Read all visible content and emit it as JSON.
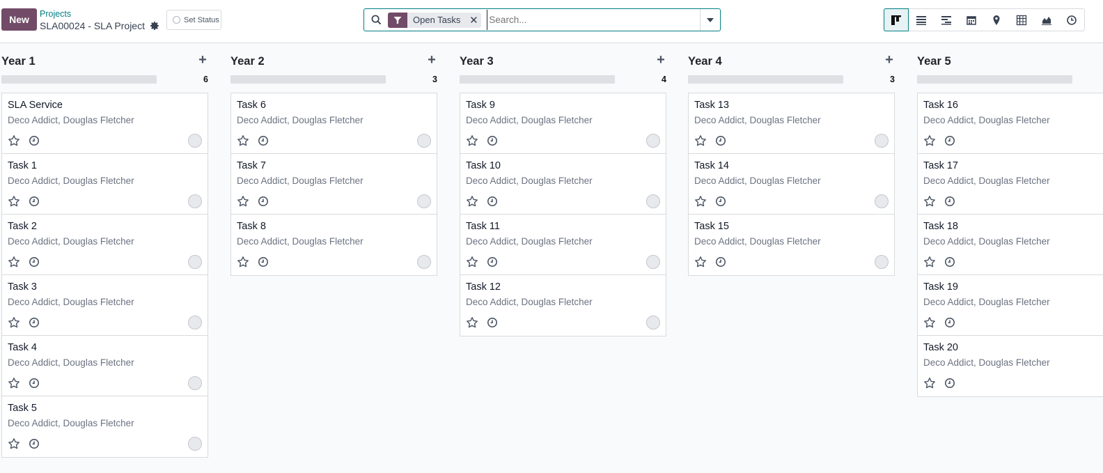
{
  "topbar": {
    "new_label": "New",
    "breadcrumb_parent": "Projects",
    "breadcrumb_current": "SLA00024 - SLA Project",
    "set_status_label": "Set Status"
  },
  "search": {
    "facet_label": "Open Tasks",
    "placeholder": "Search..."
  },
  "views": [
    {
      "name": "kanban",
      "icon": "kanban-icon",
      "active": true
    },
    {
      "name": "list",
      "icon": "list-icon",
      "active": false
    },
    {
      "name": "gantt",
      "icon": "gantt-icon",
      "active": false
    },
    {
      "name": "calendar",
      "icon": "calendar-icon",
      "active": false
    },
    {
      "name": "map",
      "icon": "map-marker-icon",
      "active": false
    },
    {
      "name": "pivot",
      "icon": "pivot-table-icon",
      "active": false
    },
    {
      "name": "graph",
      "icon": "area-chart-icon",
      "active": false
    },
    {
      "name": "activity",
      "icon": "clock-icon",
      "active": false
    }
  ],
  "colors": {
    "brand": "#714b67",
    "accent": "#017e84"
  },
  "columns": [
    {
      "title": "Year 1",
      "count": "6",
      "cards": [
        {
          "title": "SLA Service",
          "subtitle": "Deco Addict, Douglas Fletcher"
        },
        {
          "title": "Task 1",
          "subtitle": "Deco Addict, Douglas Fletcher"
        },
        {
          "title": "Task 2",
          "subtitle": "Deco Addict, Douglas Fletcher"
        },
        {
          "title": "Task 3",
          "subtitle": "Deco Addict, Douglas Fletcher"
        },
        {
          "title": "Task 4",
          "subtitle": "Deco Addict, Douglas Fletcher"
        },
        {
          "title": "Task 5",
          "subtitle": "Deco Addict, Douglas Fletcher"
        }
      ]
    },
    {
      "title": "Year 2",
      "count": "3",
      "cards": [
        {
          "title": "Task 6",
          "subtitle": "Deco Addict, Douglas Fletcher"
        },
        {
          "title": "Task 7",
          "subtitle": "Deco Addict, Douglas Fletcher"
        },
        {
          "title": "Task 8",
          "subtitle": "Deco Addict, Douglas Fletcher"
        }
      ]
    },
    {
      "title": "Year 3",
      "count": "4",
      "cards": [
        {
          "title": "Task 9",
          "subtitle": "Deco Addict, Douglas Fletcher"
        },
        {
          "title": "Task 10",
          "subtitle": "Deco Addict, Douglas Fletcher"
        },
        {
          "title": "Task 11",
          "subtitle": "Deco Addict, Douglas Fletcher"
        },
        {
          "title": "Task 12",
          "subtitle": "Deco Addict, Douglas Fletcher"
        }
      ]
    },
    {
      "title": "Year 4",
      "count": "3",
      "cards": [
        {
          "title": "Task 13",
          "subtitle": "Deco Addict, Douglas Fletcher"
        },
        {
          "title": "Task 14",
          "subtitle": "Deco Addict, Douglas Fletcher"
        },
        {
          "title": "Task 15",
          "subtitle": "Deco Addict, Douglas Fletcher"
        }
      ]
    },
    {
      "title": "Year 5",
      "count": "",
      "cards": [
        {
          "title": "Task 16",
          "subtitle": "Deco Addict, Douglas Fletcher"
        },
        {
          "title": "Task 17",
          "subtitle": "Deco Addict, Douglas Fletcher"
        },
        {
          "title": "Task 18",
          "subtitle": "Deco Addict, Douglas Fletcher"
        },
        {
          "title": "Task 19",
          "subtitle": "Deco Addict, Douglas Fletcher"
        },
        {
          "title": "Task 20",
          "subtitle": "Deco Addict, Douglas Fletcher"
        }
      ]
    }
  ]
}
